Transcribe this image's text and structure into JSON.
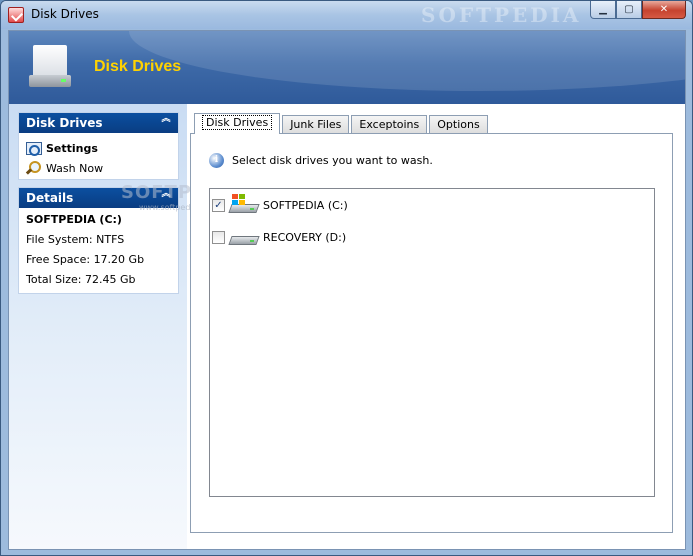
{
  "window": {
    "title": "Disk Drives",
    "title_watermark": "SOFTPEDIA",
    "buttons": {
      "minimize": "▁",
      "maximize": "▢",
      "close": "✕"
    }
  },
  "header": {
    "title": "Disk Drives"
  },
  "left_panel": {
    "tasks": {
      "title": "Disk Drives",
      "collapse_glyph": "︽",
      "items": [
        {
          "label": "Settings",
          "icon": "settings-icon",
          "bold": true
        },
        {
          "label": "Wash Now",
          "icon": "search-icon",
          "bold": false
        }
      ]
    },
    "details": {
      "title": "Details",
      "collapse_glyph": "︽",
      "drive_name": "SOFTPEDIA (C:)",
      "file_system": "File System: NTFS",
      "free_space": "Free Space: 17.20 Gb",
      "total_size": "Total Size: 72.45 Gb"
    },
    "watermark": "SOFTPEDIA",
    "watermark_sub": "www.softpedia.com"
  },
  "tabs": [
    {
      "label": "Disk Drives",
      "active": true
    },
    {
      "label": "Junk Files",
      "active": false
    },
    {
      "label": "Exceptoins",
      "active": false
    },
    {
      "label": "Options",
      "active": false
    }
  ],
  "disk_drives_tab": {
    "hint": "Select disk drives you want to wash.",
    "info_glyph": "i",
    "drives": [
      {
        "label": "SOFTPEDIA (C:)",
        "checked": true,
        "check_glyph": "✓",
        "icon": "windows-drive-icon"
      },
      {
        "label": "RECOVERY (D:)",
        "checked": false,
        "check_glyph": "",
        "icon": "hard-drive-icon"
      }
    ]
  }
}
